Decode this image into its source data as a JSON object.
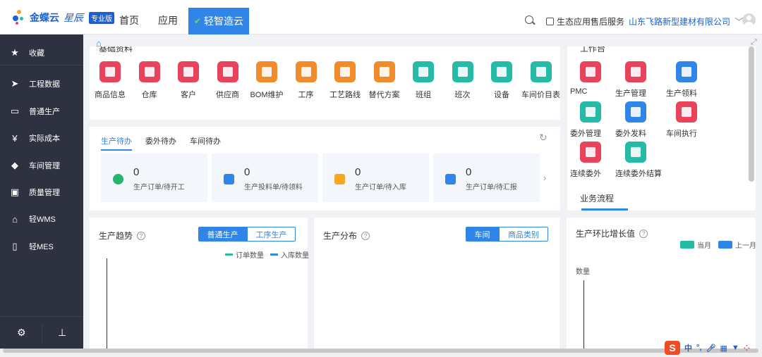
{
  "logo": {
    "brand": "金蝶云",
    "sub": "星辰",
    "badge": "专业版"
  },
  "nav": {
    "home": "首页",
    "apps": "应用",
    "active": "轻智造云"
  },
  "topright": {
    "service": "生态应用售后服务",
    "company": "山东飞路新型建材有限公司"
  },
  "sidebar": {
    "items": [
      {
        "label": "收藏",
        "icon": "star-icon"
      },
      {
        "label": "工程数据",
        "icon": "paper-plane-icon"
      },
      {
        "label": "普通生产",
        "icon": "monitor-icon"
      },
      {
        "label": "实际成本",
        "icon": "yen-icon"
      },
      {
        "label": "车间管理",
        "icon": "layers-icon"
      },
      {
        "label": "质量管理",
        "icon": "magnifier-icon"
      },
      {
        "label": "轻WMS",
        "icon": "warehouse-icon"
      },
      {
        "label": "轻MES",
        "icon": "tablet-icon"
      }
    ]
  },
  "basic": {
    "title": "基础资料",
    "apps": [
      {
        "name": "商品信息",
        "color": "#e8435b"
      },
      {
        "name": "仓库",
        "color": "#e8435b"
      },
      {
        "name": "客户",
        "color": "#e8435b"
      },
      {
        "name": "供应商",
        "color": "#e8435b"
      },
      {
        "name": "BOM维护",
        "color": "#f28b2b"
      },
      {
        "name": "工序",
        "color": "#f28b2b"
      },
      {
        "name": "工艺路线",
        "color": "#f28b2b"
      },
      {
        "name": "替代方案",
        "color": "#f28b2b"
      },
      {
        "name": "班组",
        "color": "#26bba6"
      },
      {
        "name": "班次",
        "color": "#26bba6"
      },
      {
        "name": "设备",
        "color": "#26bba6"
      },
      {
        "name": "车间价目表",
        "color": "#26bba6"
      }
    ]
  },
  "workbench": {
    "title": "工作台",
    "apps": [
      {
        "name": "PMC",
        "color": "#e8435b"
      },
      {
        "name": "生产管理",
        "color": "#e8435b"
      },
      {
        "name": "生产领料",
        "color": "#2f86e8"
      },
      {
        "name": "委外管理",
        "color": "#26bba6"
      },
      {
        "name": "委外发料",
        "color": "#2f86e8"
      },
      {
        "name": "车间执行",
        "color": "#e8435b"
      },
      {
        "name": "连续委外",
        "color": "#e8435b"
      },
      {
        "name": "连续委外结算",
        "color": "#26bba6"
      }
    ],
    "workflow_label": "业务流程"
  },
  "todo": {
    "tabs": [
      "生产待办",
      "委外待办",
      "车间待办"
    ],
    "cards": [
      {
        "count": "0",
        "label": "生产订单/待开工",
        "color": "#26b36c"
      },
      {
        "count": "0",
        "label": "生产投料单/待领料",
        "color": "#2f86e8"
      },
      {
        "count": "0",
        "label": "生产订单/待入库",
        "color": "#f5a623"
      },
      {
        "count": "0",
        "label": "生产订单/待汇报",
        "color": "#2f86e8"
      }
    ]
  },
  "trend": {
    "title": "生产趋势",
    "seg": [
      "普通生产",
      "工序生产"
    ],
    "legend": [
      {
        "name": "订单数量",
        "color": "#26bba6"
      },
      {
        "name": "入库数量",
        "color": "#2f86e8"
      }
    ]
  },
  "distribution": {
    "title": "生产分布",
    "seg": [
      "车间",
      "商品类别"
    ]
  },
  "growth": {
    "title": "生产环比增长值",
    "legend": [
      {
        "name": "当月",
        "color": "#26bba6"
      },
      {
        "name": "上一月",
        "color": "#2f86e8"
      }
    ],
    "ylabel": "数量"
  },
  "ime": {
    "lang": "中"
  }
}
